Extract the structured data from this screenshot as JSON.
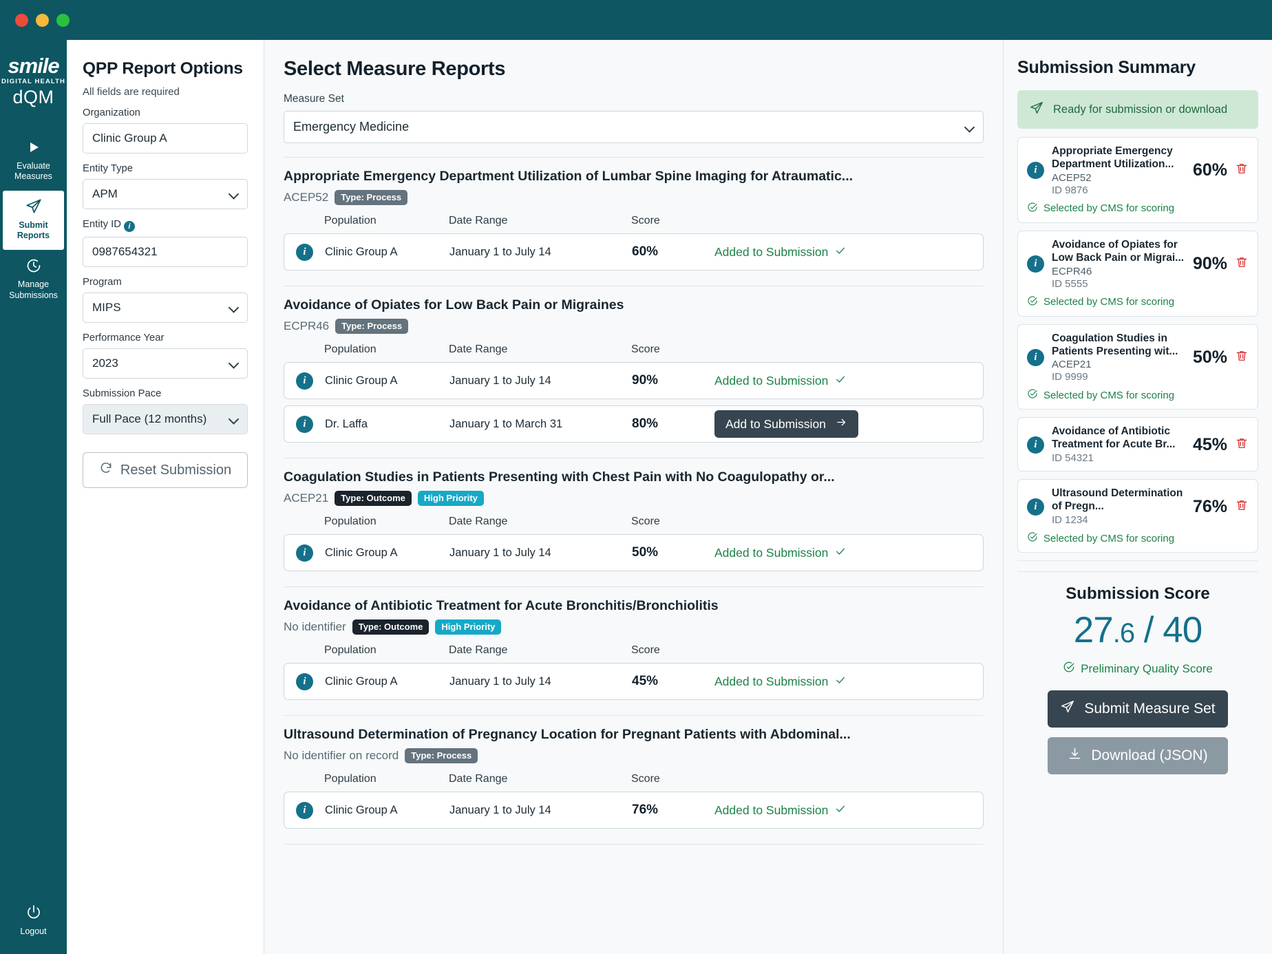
{
  "window": {
    "dots": [
      "close",
      "minimize",
      "maximize"
    ]
  },
  "sidebar": {
    "logo": {
      "brand": "smile",
      "tagline": "DIGITAL HEALTH",
      "product": "dQM"
    },
    "items": [
      {
        "label_line1": "Evaluate",
        "label_line2": "Measures",
        "icon": "play-icon",
        "active": false
      },
      {
        "label_line1": "Submit",
        "label_line2": "Reports",
        "icon": "paper-plane-icon",
        "active": true
      },
      {
        "label_line1": "Manage",
        "label_line2": "Submissions",
        "icon": "clock-icon",
        "active": false
      }
    ],
    "logout": {
      "label": "Logout",
      "icon": "power-icon"
    }
  },
  "options": {
    "title": "QPP Report Options",
    "subtitle": "All fields are required",
    "fields": [
      {
        "label": "Organization",
        "value": "Clinic Group A",
        "type": "text",
        "info": false
      },
      {
        "label": "Entity Type",
        "value": "APM",
        "type": "select",
        "info": false
      },
      {
        "label": "Entity ID",
        "value": "0987654321",
        "type": "text",
        "info": true
      },
      {
        "label": "Program",
        "value": "MIPS",
        "type": "select",
        "info": false
      },
      {
        "label": "Performance Year",
        "value": "2023",
        "type": "select",
        "info": false
      },
      {
        "label": "Submission Pace",
        "value": "Full Pace (12 months)",
        "type": "select",
        "info": false,
        "muted": true
      }
    ],
    "reset_button": {
      "label": "Reset Submission",
      "icon": "refresh-icon"
    }
  },
  "measures_panel": {
    "title": "Select Measure  Reports",
    "measure_set_label": "Measure Set",
    "measure_set_value": "Emergency Medicine",
    "columns": {
      "population": "Population",
      "date_range": "Date Range",
      "score": "Score"
    },
    "measures": [
      {
        "title": "Appropriate Emergency Department Utilization of Lumbar Spine Imaging for Atraumatic...",
        "code": "ACEP52",
        "badges": [
          {
            "text": "Type: Process",
            "style": "process"
          }
        ],
        "rows": [
          {
            "population": "Clinic Group A",
            "date_range": "January 1 to July 14",
            "score": "60%",
            "action": "Added to Submission",
            "state": "added"
          }
        ]
      },
      {
        "title": "Avoidance of Opiates for Low Back Pain or Migraines",
        "code": "ECPR46",
        "badges": [
          {
            "text": "Type: Process",
            "style": "process"
          }
        ],
        "rows": [
          {
            "population": "Clinic Group A",
            "date_range": "January 1 to July 14",
            "score": "90%",
            "action": "Added to Submission",
            "state": "added"
          },
          {
            "population": "Dr. Laffa",
            "date_range": "January 1 to March 31",
            "score": "80%",
            "action": "Add to Submission",
            "state": "add"
          }
        ]
      },
      {
        "title": "Coagulation Studies in Patients Presenting with Chest Pain with No Coagulopathy or...",
        "code": "ACEP21",
        "badges": [
          {
            "text": "Type: Outcome",
            "style": "outcome"
          },
          {
            "text": "High Priority",
            "style": "priority"
          }
        ],
        "rows": [
          {
            "population": "Clinic Group A",
            "date_range": "January 1 to July 14",
            "score": "50%",
            "action": "Added to Submission",
            "state": "added"
          }
        ]
      },
      {
        "title": "Avoidance of Antibiotic Treatment for Acute Bronchitis/Bronchiolitis",
        "code": "No identifier",
        "badges": [
          {
            "text": "Type: Outcome",
            "style": "outcome"
          },
          {
            "text": "High Priority",
            "style": "priority"
          }
        ],
        "rows": [
          {
            "population": "Clinic Group A",
            "date_range": "January 1 to July 14",
            "score": "45%",
            "action": "Added to Submission",
            "state": "added"
          }
        ]
      },
      {
        "title": "Ultrasound Determination of Pregnancy Location for Pregnant Patients with Abdominal...",
        "code": "No identifier on record",
        "badges": [
          {
            "text": "Type: Process",
            "style": "process"
          }
        ],
        "rows": [
          {
            "population": "Clinic Group A",
            "date_range": "January 1 to July 14",
            "score": "76%",
            "action": "Added to Submission",
            "state": "added"
          }
        ]
      }
    ]
  },
  "summary": {
    "title": "Submission Summary",
    "ready_banner": {
      "text": "Ready for submission or download",
      "icon": "paper-plane-icon"
    },
    "cards": [
      {
        "name": "Appropriate Emergency Department Utilization...",
        "code": "ACEP52",
        "id": "ID 9876",
        "percent": "60%",
        "footer": "Selected by CMS for scoring"
      },
      {
        "name": "Avoidance of Opiates for Low Back Pain or Migrai...",
        "code": "ECPR46",
        "id": "ID 5555",
        "percent": "90%",
        "footer": "Selected by CMS for scoring"
      },
      {
        "name": "Coagulation Studies in Patients Presenting wit...",
        "code": "ACEP21",
        "id": "ID 9999",
        "percent": "50%",
        "footer": "Selected by CMS for scoring"
      },
      {
        "name": "Avoidance of Antibiotic Treatment for Acute Br...",
        "code": "",
        "id": "ID 54321",
        "percent": "45%",
        "footer": ""
      },
      {
        "name": "Ultrasound Determination of Pregn...",
        "code": "",
        "id": "ID 1234",
        "percent": "76%",
        "footer": "Selected by CMS for scoring"
      }
    ],
    "score": {
      "label": "Submission Score",
      "whole": "27",
      "decimal": ".6",
      "total": " / 40",
      "preliminary": "Preliminary Quality Score"
    },
    "submit_button": {
      "label": "Submit Measure Set",
      "icon": "paper-plane-icon"
    },
    "download_button": {
      "label": "Download (JSON)",
      "icon": "download-icon"
    }
  },
  "colors": {
    "brand_teal": "#0d5662",
    "accent_teal": "#15708a",
    "success_green": "#1d8348",
    "dark_button": "#36454f",
    "priority_cyan": "#16a9c7",
    "danger_red": "#d63031"
  }
}
